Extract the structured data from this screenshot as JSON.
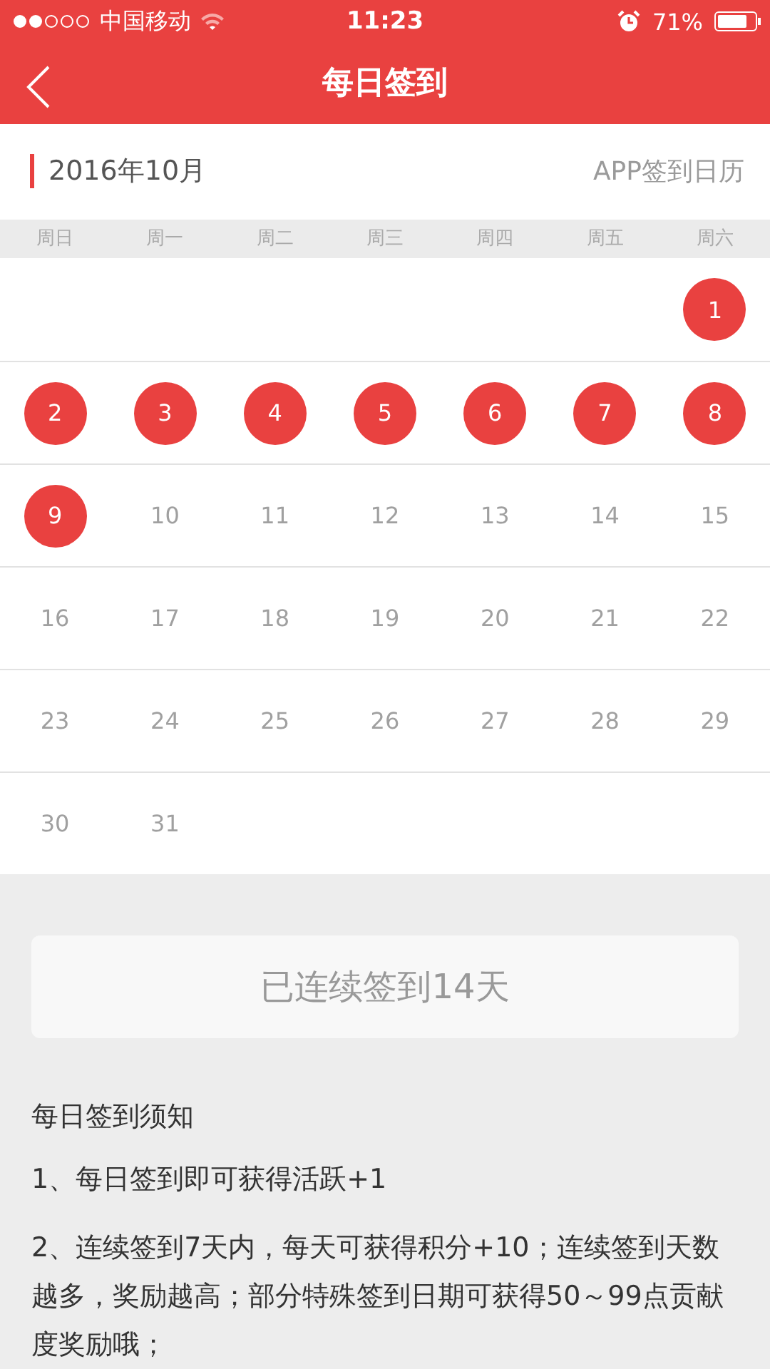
{
  "status_bar": {
    "carrier": "中国移动",
    "time": "11:23",
    "battery": "71%"
  },
  "nav": {
    "title": "每日签到"
  },
  "calendar": {
    "month": "2016年10月",
    "caption": "APP签到日历",
    "weekdays": [
      "周日",
      "周一",
      "周二",
      "周三",
      "周四",
      "周五",
      "周六"
    ],
    "weeks": [
      {
        "kind": "trailing",
        "days": [
          {
            "day": "1",
            "signed": true
          }
        ]
      },
      {
        "kind": "full",
        "days": [
          {
            "day": "2",
            "signed": true
          },
          {
            "day": "3",
            "signed": true
          },
          {
            "day": "4",
            "signed": true
          },
          {
            "day": "5",
            "signed": true
          },
          {
            "day": "6",
            "signed": true
          },
          {
            "day": "7",
            "signed": true
          },
          {
            "day": "8",
            "signed": true
          }
        ]
      },
      {
        "kind": "full",
        "days": [
          {
            "day": "9",
            "signed": true
          },
          {
            "day": "10",
            "signed": false
          },
          {
            "day": "11",
            "signed": false
          },
          {
            "day": "12",
            "signed": false
          },
          {
            "day": "13",
            "signed": false
          },
          {
            "day": "14",
            "signed": false
          },
          {
            "day": "15",
            "signed": false
          }
        ]
      },
      {
        "kind": "full",
        "days": [
          {
            "day": "16",
            "signed": false
          },
          {
            "day": "17",
            "signed": false
          },
          {
            "day": "18",
            "signed": false
          },
          {
            "day": "19",
            "signed": false
          },
          {
            "day": "20",
            "signed": false
          },
          {
            "day": "21",
            "signed": false
          },
          {
            "day": "22",
            "signed": false
          }
        ]
      },
      {
        "kind": "full",
        "days": [
          {
            "day": "23",
            "signed": false
          },
          {
            "day": "24",
            "signed": false
          },
          {
            "day": "25",
            "signed": false
          },
          {
            "day": "26",
            "signed": false
          },
          {
            "day": "27",
            "signed": false
          },
          {
            "day": "28",
            "signed": false
          },
          {
            "day": "29",
            "signed": false
          }
        ]
      },
      {
        "kind": "leading",
        "days": [
          {
            "day": "30",
            "signed": false
          },
          {
            "day": "31",
            "signed": false
          }
        ]
      }
    ]
  },
  "streak": "已连续签到14天",
  "notes": {
    "title": "每日签到须知",
    "items": [
      "1、每日签到即可获得活跃+1",
      "2、连续签到7天内，每天可获得积分+10；连续签到天数越多，奖励越高；部分特殊签到日期可获得50～99点贡献度奖励哦；"
    ]
  }
}
